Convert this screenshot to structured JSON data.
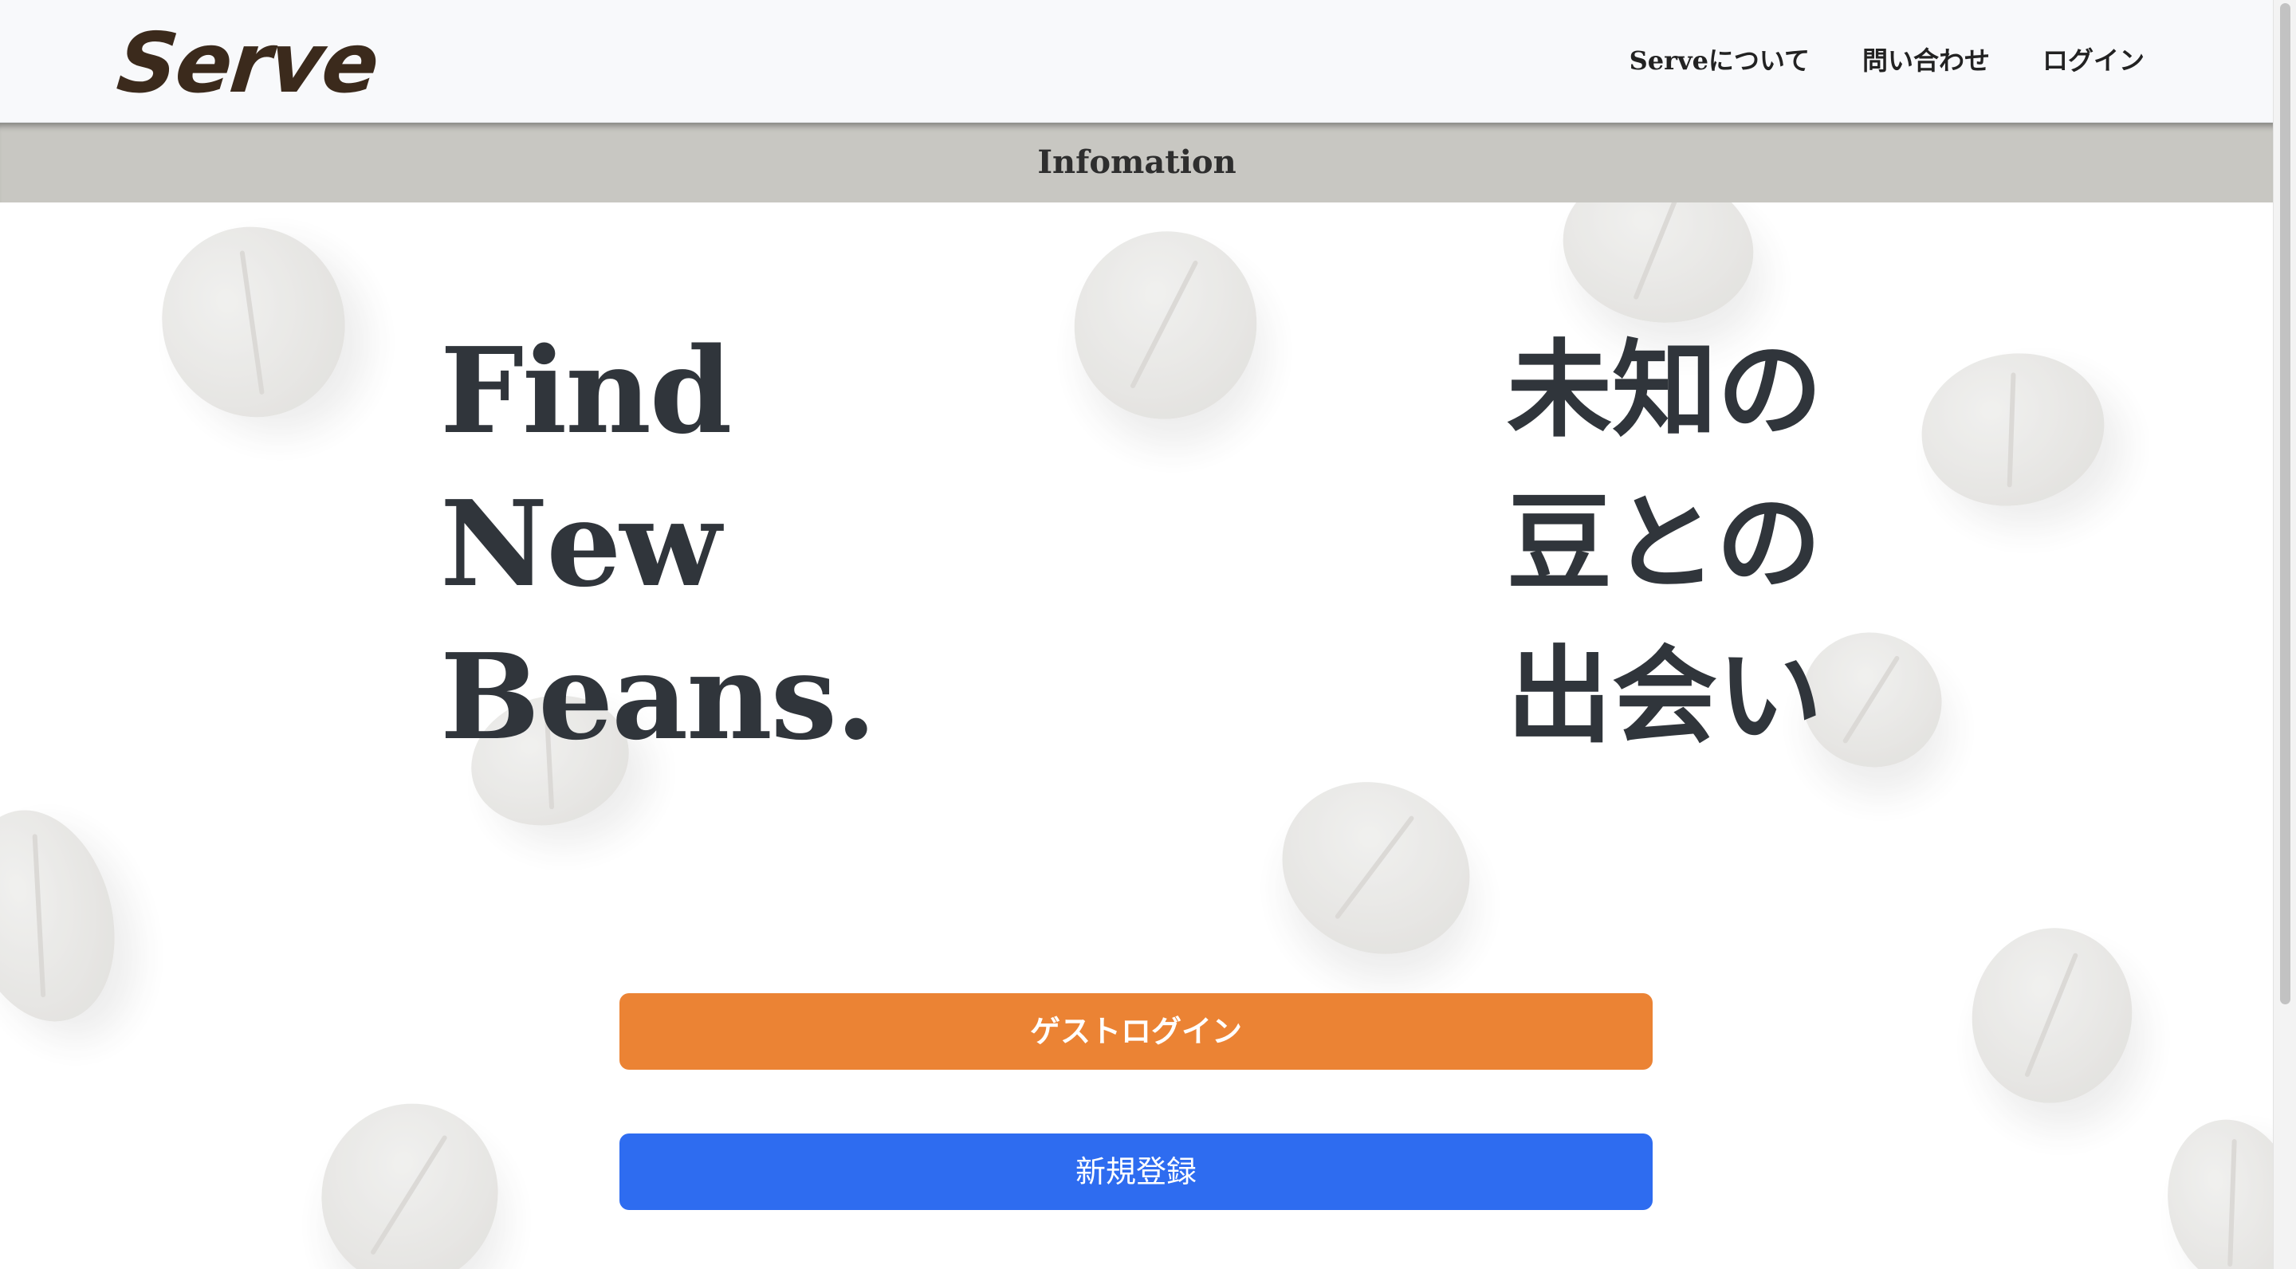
{
  "header": {
    "logo": "Serve",
    "nav": {
      "about": "Serveについて",
      "contact": "問い合わせ",
      "login": "ログイン"
    }
  },
  "info_bar": {
    "label": "Infomation"
  },
  "hero": {
    "english_lines": [
      "Find",
      "New",
      "Beans."
    ],
    "japanese_lines": [
      "未知の",
      "豆との",
      "出会い"
    ]
  },
  "actions": {
    "guest_login": "ゲストログイン",
    "register": "新規登録"
  },
  "colors": {
    "logo": "#3b2a1c",
    "guest_button": "#eb8334",
    "register_button": "#2e6cf0",
    "info_bar": "#c8c7c2",
    "hero_text": "#30353b"
  }
}
